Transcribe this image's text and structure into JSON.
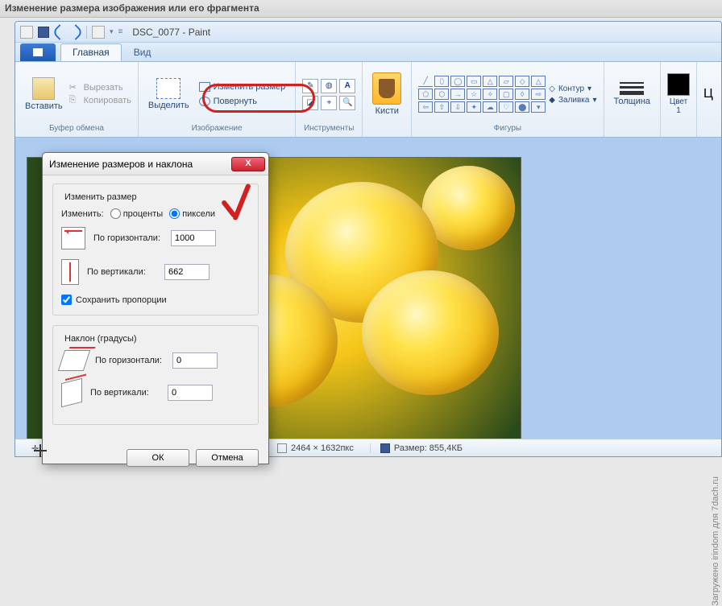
{
  "outer_title": "Изменение размера изображения или его фрагмента",
  "window_title": "DSC_0077 - Paint",
  "tabs": {
    "home": "Главная",
    "view": "Вид"
  },
  "ribbon": {
    "clipboard": {
      "label": "Буфер обмена",
      "paste": "Вставить",
      "cut": "Вырезать",
      "copy": "Копировать"
    },
    "image": {
      "label": "Изображение",
      "select": "Выделить",
      "resize": "Изменить размер",
      "rotate": "Повернуть"
    },
    "tools": {
      "label": "Инструменты"
    },
    "brushes": {
      "label": "Кисти"
    },
    "shapes": {
      "label": "Фигуры",
      "outline": "Контур",
      "fill": "Заливка"
    },
    "thickness": {
      "label": "Толщина"
    },
    "color1": {
      "label": "Цвет\n1"
    },
    "colors_more": "Ц"
  },
  "dialog": {
    "title": "Изменение размеров и наклона",
    "resize_section": "Изменить размер",
    "by_label": "Изменить:",
    "percent": "проценты",
    "pixels": "пиксели",
    "horizontal": "По горизонтали:",
    "vertical": "По вертикали:",
    "h_value": "1000",
    "v_value": "662",
    "keep_ratio": "Сохранить пропорции",
    "skew_section": "Наклон (градусы)",
    "skew_h": "0",
    "skew_v": "0",
    "ok": "ОК",
    "cancel": "Отмена"
  },
  "status": {
    "dims": "2464 × 1632пкс",
    "size_label": "Размер: 855,4КБ"
  },
  "watermark": "Загружено irindom для 7dach.ru"
}
